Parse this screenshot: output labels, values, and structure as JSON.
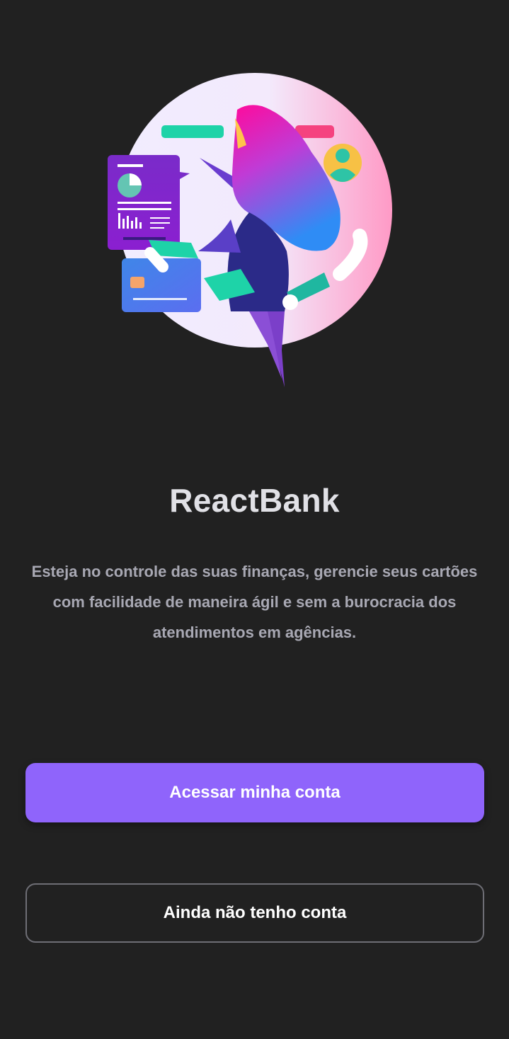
{
  "app": {
    "title": "ReactBank",
    "description": "Esteja no controle das suas finanças, gerencie seus cartões com facilidade de maneira ágil e sem a burocracia dos atendimentos em agências."
  },
  "actions": {
    "login_label": "Acessar minha conta",
    "signup_label": "Ainda não tenho conta"
  },
  "colors": {
    "background": "#212121",
    "primary": "#8f64fb",
    "title": "#e1e1e6",
    "text": "#a8a8b3"
  },
  "illustration": {
    "icon": "finance-woman-illustration"
  }
}
